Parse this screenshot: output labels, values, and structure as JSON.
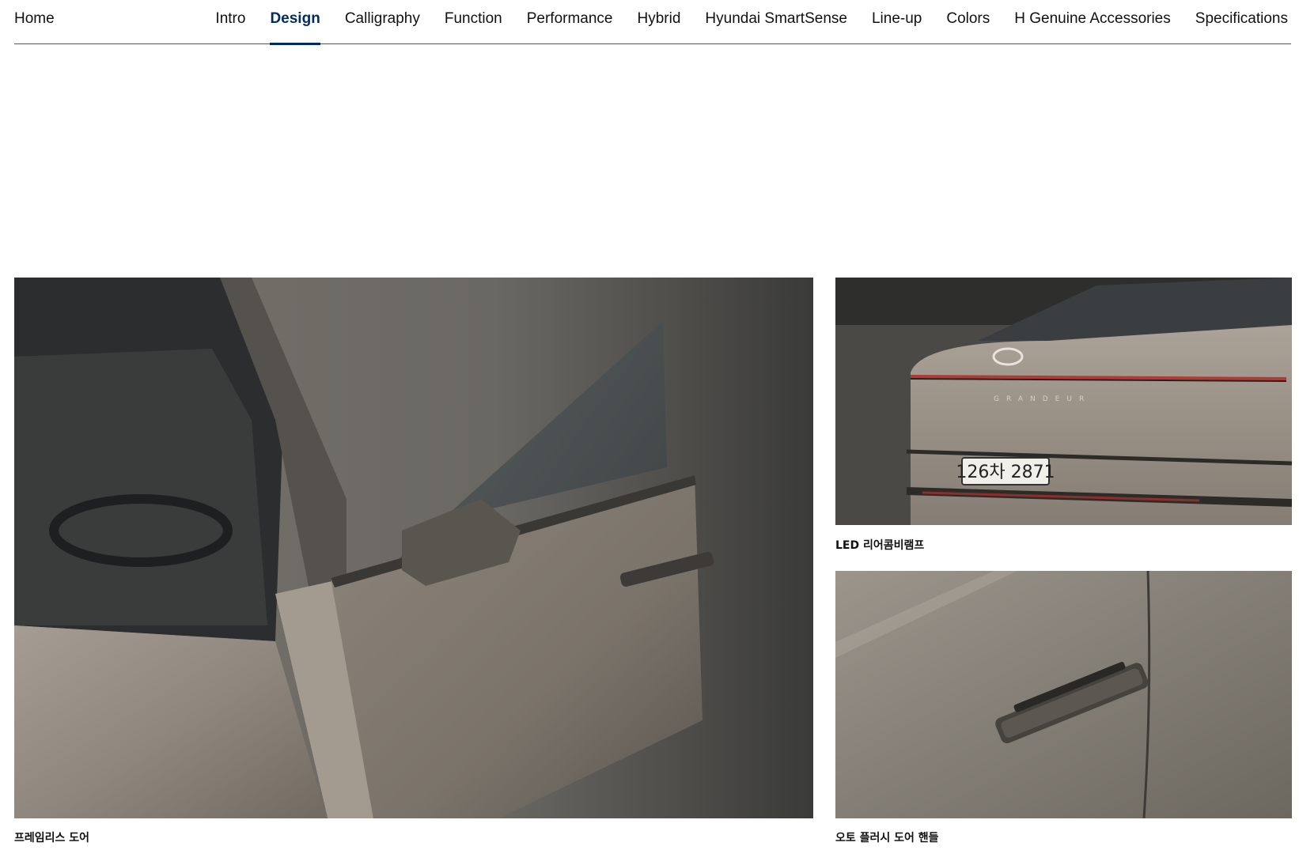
{
  "nav": {
    "home": "Home",
    "tabs": [
      {
        "label": "Intro",
        "active": false
      },
      {
        "label": "Design",
        "active": true
      },
      {
        "label": "Calligraphy",
        "active": false
      },
      {
        "label": "Function",
        "active": false
      },
      {
        "label": "Performance",
        "active": false
      },
      {
        "label": "Hybrid",
        "active": false
      },
      {
        "label": "Hyundai SmartSense",
        "active": false
      },
      {
        "label": "Line-up",
        "active": false
      },
      {
        "label": "Colors",
        "active": false
      },
      {
        "label": "H Genuine Accessories",
        "active": false
      },
      {
        "label": "Specifications",
        "active": false
      }
    ],
    "accent_color": "#002c5f"
  },
  "gallery": {
    "main": {
      "caption": "프레임리스 도어"
    },
    "rear": {
      "caption": "LED 리어콤비램프",
      "plate": "126차 2871",
      "badge": "GRANDEUR"
    },
    "handle": {
      "caption": "오토 플러시 도어 핸들"
    }
  }
}
